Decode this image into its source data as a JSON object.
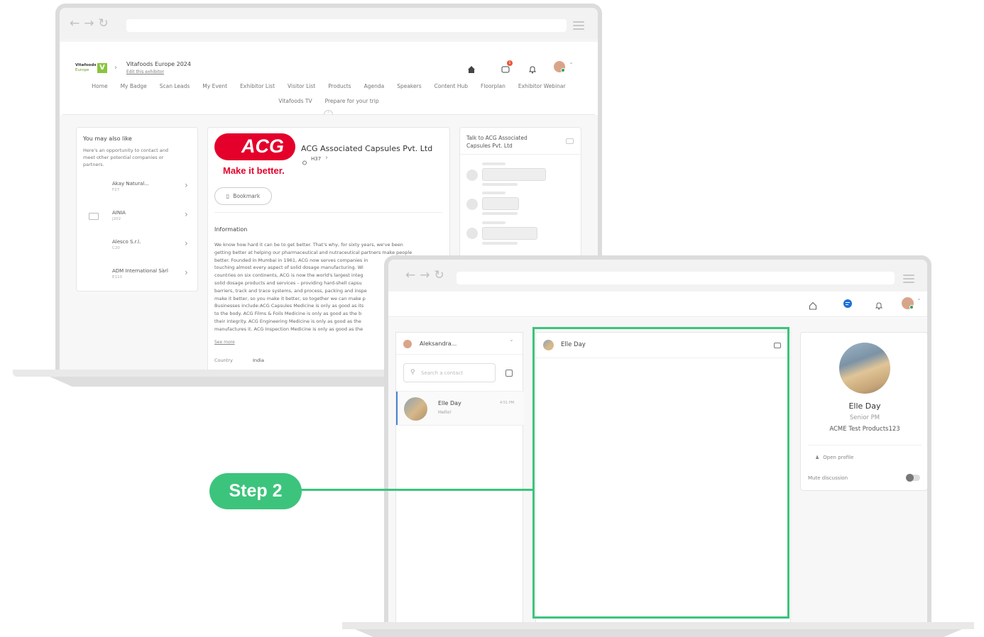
{
  "back_window": {
    "header": {
      "event_title": "Vitafoods Europe 2024",
      "edit_link": "Edit this exhibitor",
      "logo_text_1": "Vitafoods",
      "logo_text_2": "Europe",
      "logo_letter": "V",
      "notification_count": "1"
    },
    "nav": {
      "items_row1": [
        "Home",
        "My Badge",
        "Scan Leads",
        "My Event",
        "Exhibitor List",
        "Visitor List",
        "Products",
        "Agenda",
        "Speakers",
        "Content Hub",
        "Floorplan",
        "Exhibitor Webinar"
      ],
      "items_row2": [
        "Vitafoods TV",
        "Prepare for your trip"
      ]
    },
    "suggestions": {
      "title": "You may also like",
      "description_lines": [
        "Here's an opportunity to contact and",
        "meet other potential companies or",
        "partners."
      ],
      "items": [
        {
          "name": "Akay Natural...",
          "stand": "F27"
        },
        {
          "name": "AINIA",
          "stand": "J202"
        },
        {
          "name": "Alesco S.r.l.",
          "stand": "C20"
        },
        {
          "name": "ADM International Sàrl",
          "stand": "E110"
        }
      ]
    },
    "company": {
      "logo_text": "ACG",
      "tagline": "Make it better.",
      "name": "ACG Associated Capsules Pvt. Ltd",
      "stand": "H37",
      "bookmark_label": "Bookmark",
      "info_title": "Information",
      "info_lines": [
        "We know how hard it can be to get better. That's why, for sixty years, we've been",
        "getting better at helping our pharmaceutical and nutraceutical partners make people",
        "better. Founded in Mumbai in 1961, ACG now serves companies in",
        "touching almost every aspect of solid dosage manufacturing. Wi",
        "countries on six continents, ACG is now the world's largest integ",
        "solid dosage products and services – providing hard-shell capsu",
        "barriers, track and trace systems, and process, packing and inspe",
        "make it better, so you make it better, so together we can make p",
        "Businesses include:ACG Capsules Medicine is only as good as its",
        "to the body. ACG Films & Foils Medicine is only as good as the b",
        "their integrity. ACG Engineering Medicine is only as good as the",
        "manufactures it. ACG Inspection Medicine is only as good as the"
      ],
      "see_more": "See more",
      "country_label": "Country",
      "country_value": "India"
    },
    "talk_card": {
      "title_line1": "Talk to ACG Associated",
      "title_line2": "Capsules Pvt. Ltd"
    }
  },
  "front_window": {
    "contacts_header": {
      "name": "Aleksandra..."
    },
    "search": {
      "placeholder": "Search a contact"
    },
    "conversation": {
      "name": "Elle Day",
      "preview": "Hello!",
      "time": "4:51 PM"
    },
    "chat_header": {
      "name": "Elle Day"
    },
    "profile": {
      "name": "Elle Day",
      "role": "Senior PM",
      "company": "ACME Test Products123",
      "open_profile": "Open profile",
      "mute_label": "Mute discussion"
    }
  },
  "callout": {
    "label": "Step 2"
  },
  "colors": {
    "accent_green": "#3cc47c",
    "acg_red": "#e4002b",
    "chat_blue": "#1e6fd9"
  }
}
